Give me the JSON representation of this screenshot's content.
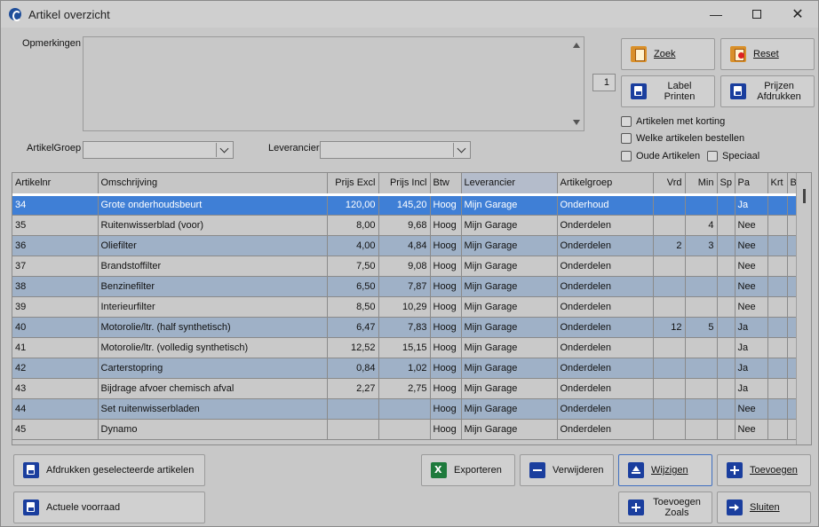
{
  "window": {
    "title": "Artikel overzicht",
    "controls": [
      "minimize",
      "maximize",
      "close"
    ]
  },
  "labels": {
    "opmerkingen": "Opmerkingen",
    "artikelgroep": "ArtikelGroep",
    "leverancier": "Leverancier"
  },
  "filters": {
    "artikelgroep_value": "",
    "leverancier_value": "",
    "label_count": "1"
  },
  "buttons": {
    "zoek": "Zoek",
    "reset": "Reset",
    "label_printen_1": "Label",
    "label_printen_2": "Printen",
    "prijzen_afdrukken_1": "Prijzen",
    "prijzen_afdrukken_2": "Afdrukken",
    "afdrukken_geselecteerde": "Afdrukken geselecteerde artikelen",
    "actuele_voorraad": "Actuele voorraad",
    "exporteren": "Exporteren",
    "verwijderen": "Verwijderen",
    "wijzigen": "Wijzigen",
    "toevoegen": "Toevoegen",
    "toevoegen_zoals_1": "Toevoegen",
    "toevoegen_zoals_2": "Zoals",
    "sluiten": "Sluiten"
  },
  "checkboxes": {
    "met_korting": "Artikelen met korting",
    "bestellen": "Welke artikelen bestellen",
    "oude": "Oude Artikelen",
    "speciaal": "Speciaal"
  },
  "table": {
    "headers": [
      "Artikelnr",
      "Omschrijving",
      "Prijs Excl",
      "Prijs Incl",
      "Btw",
      "Leverancier",
      "Artikelgroep",
      "Vrd",
      "Min",
      "Sp",
      "Pa",
      "Krt",
      "B"
    ],
    "rows": [
      [
        "34",
        "Grote onderhoudsbeurt",
        "120,00",
        "145,20",
        "Hoog",
        "Mijn Garage",
        "Onderhoud",
        "",
        "",
        "",
        "Ja",
        "",
        ""
      ],
      [
        "35",
        "Ruitenwisserblad (voor)",
        "8,00",
        "9,68",
        "Hoog",
        "Mijn Garage",
        "Onderdelen",
        "",
        "4",
        "",
        "Nee",
        "",
        ""
      ],
      [
        "36",
        "Oliefilter",
        "4,00",
        "4,84",
        "Hoog",
        "Mijn Garage",
        "Onderdelen",
        "2",
        "3",
        "",
        "Nee",
        "",
        ""
      ],
      [
        "37",
        "Brandstoffilter",
        "7,50",
        "9,08",
        "Hoog",
        "Mijn Garage",
        "Onderdelen",
        "",
        "",
        "",
        "Nee",
        "",
        ""
      ],
      [
        "38",
        "Benzinefilter",
        "6,50",
        "7,87",
        "Hoog",
        "Mijn Garage",
        "Onderdelen",
        "",
        "",
        "",
        "Nee",
        "",
        ""
      ],
      [
        "39",
        "Interieurfilter",
        "8,50",
        "10,29",
        "Hoog",
        "Mijn Garage",
        "Onderdelen",
        "",
        "",
        "",
        "Nee",
        "",
        ""
      ],
      [
        "40",
        "Motorolie/ltr. (half synthetisch)",
        "6,47",
        "7,83",
        "Hoog",
        "Mijn Garage",
        "Onderdelen",
        "12",
        "5",
        "",
        "Ja",
        "",
        ""
      ],
      [
        "41",
        "Motorolie/ltr. (volledig synthetisch)",
        "12,52",
        "15,15",
        "Hoog",
        "Mijn Garage",
        "Onderdelen",
        "",
        "",
        "",
        "Ja",
        "",
        ""
      ],
      [
        "42",
        "Carterstopring",
        "0,84",
        "1,02",
        "Hoog",
        "Mijn Garage",
        "Onderdelen",
        "",
        "",
        "",
        "Ja",
        "",
        ""
      ],
      [
        "43",
        "Bijdrage afvoer chemisch afval",
        "2,27",
        "2,75",
        "Hoog",
        "Mijn Garage",
        "Onderdelen",
        "",
        "",
        "",
        "Ja",
        "",
        ""
      ],
      [
        "44",
        "Set ruitenwisserbladen",
        "",
        "",
        "Hoog",
        "Mijn Garage",
        "Onderdelen",
        "",
        "",
        "",
        "Nee",
        "",
        ""
      ],
      [
        "45",
        "Dynamo",
        "",
        "",
        "Hoog",
        "Mijn Garage",
        "Onderdelen",
        "",
        "",
        "",
        "Nee",
        "",
        ""
      ]
    ],
    "selected_index": 0
  },
  "colors": {
    "selected_row": "#3f7fd6",
    "alt_row": "#9fb1c7",
    "button_icon": "#1a3e9e"
  }
}
